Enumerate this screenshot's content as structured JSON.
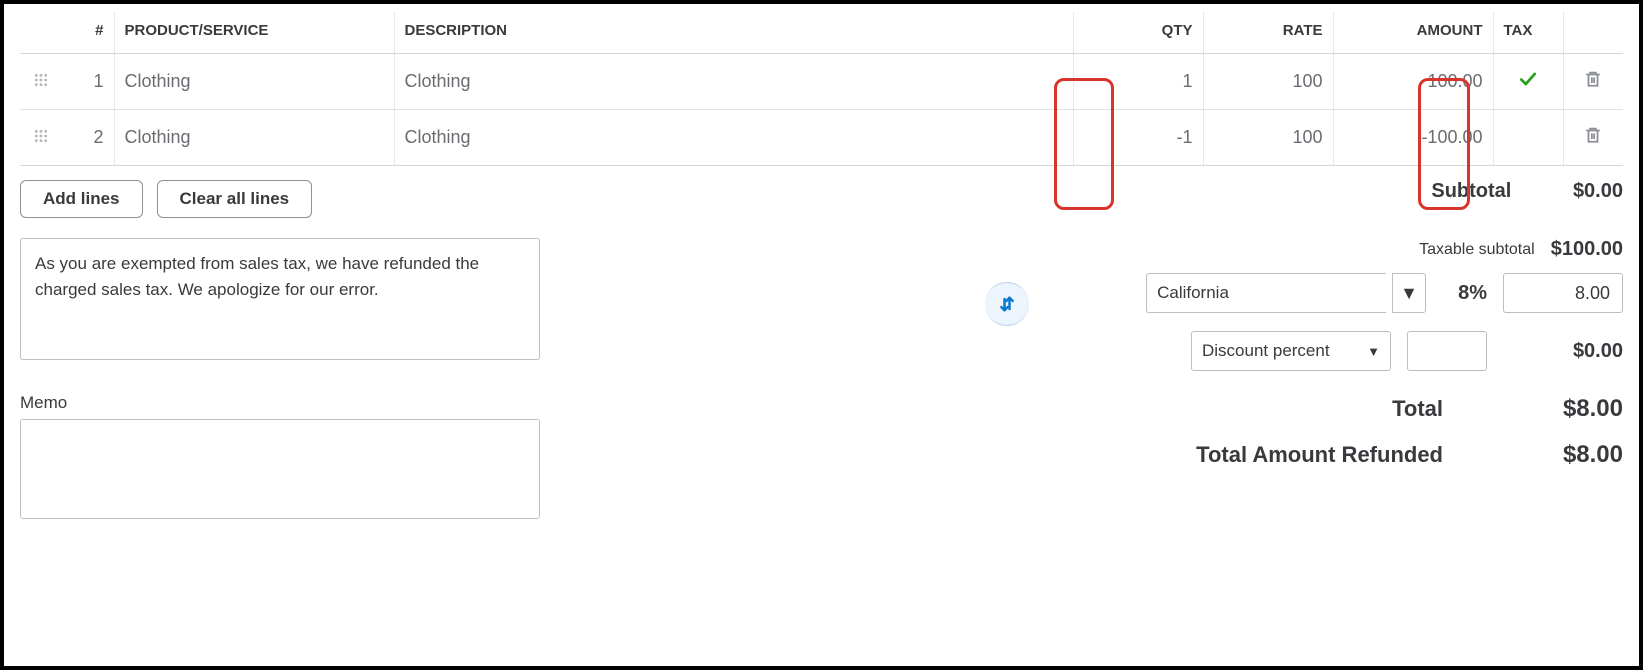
{
  "table": {
    "headers": {
      "num": "#",
      "product": "PRODUCT/SERVICE",
      "description": "DESCRIPTION",
      "qty": "QTY",
      "rate": "RATE",
      "amount": "AMOUNT",
      "tax": "TAX"
    },
    "rows": [
      {
        "num": "1",
        "product": "Clothing",
        "description": "Clothing",
        "qty": "1",
        "rate": "100",
        "amount": "100.00",
        "tax_checked": true
      },
      {
        "num": "2",
        "product": "Clothing",
        "description": "Clothing",
        "qty": "-1",
        "rate": "100",
        "amount": "-100.00",
        "tax_checked": false
      }
    ]
  },
  "buttons": {
    "add_lines": "Add lines",
    "clear_all": "Clear all lines"
  },
  "note": "As you are exempted from sales tax, we have refunded the charged sales tax. We apologize for our error.",
  "memo_label": "Memo",
  "memo_value": "",
  "totals": {
    "subtotal_label": "Subtotal",
    "subtotal_value": "$0.00",
    "taxable_subtotal_label": "Taxable subtotal",
    "taxable_subtotal_value": "$100.00",
    "tax_jurisdiction": "California",
    "tax_percent": "8%",
    "tax_amount": "8.00",
    "discount_type": "Discount percent",
    "discount_value": "",
    "discount_amount": "$0.00",
    "total_label": "Total",
    "total_value": "$8.00",
    "refunded_label": "Total Amount Refunded",
    "refunded_value": "$8.00"
  }
}
